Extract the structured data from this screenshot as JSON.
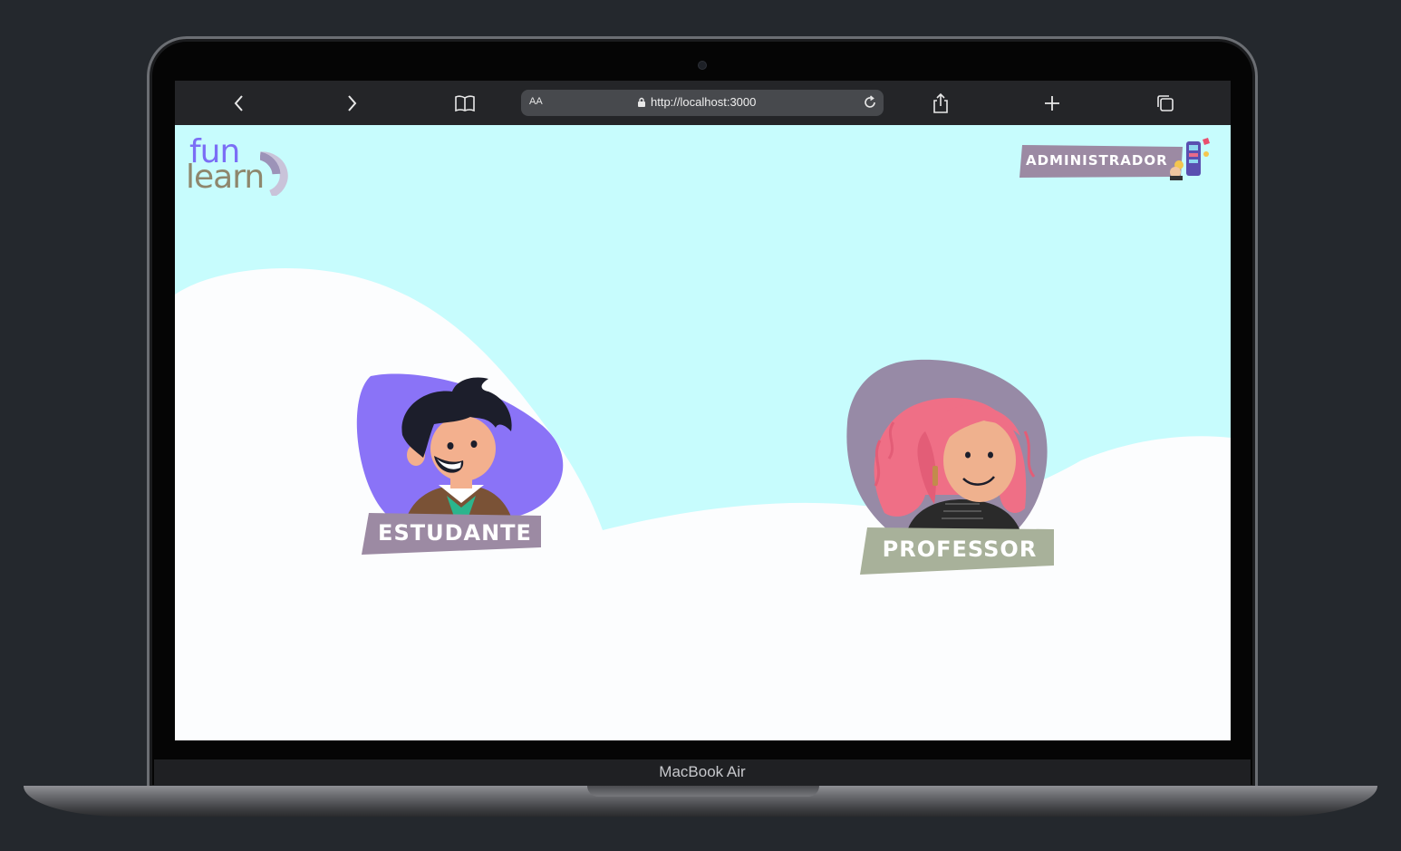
{
  "device": {
    "brand": "MacBook Air"
  },
  "browser": {
    "text_size_label": "AA",
    "url": "http://localhost:3000",
    "icons": [
      "back-icon",
      "forward-icon",
      "bookmarks-icon",
      "lock-icon",
      "reload-icon",
      "share-icon",
      "new-tab-icon",
      "tabs-icon"
    ]
  },
  "app": {
    "logo": {
      "line1": "fun",
      "line2": "learn"
    },
    "admin_button": {
      "label": "ADMINISTRADOR"
    },
    "roles": [
      {
        "label": "ESTUDANTE",
        "tag_color": "#9c8aa3",
        "blob_color": "#8a73f7"
      },
      {
        "label": "PROFESSOR",
        "tag_color": "#a8b19a",
        "blob_color": "#978aa6"
      }
    ],
    "colors": {
      "sky": "#c7fcfd",
      "ground": "#fcfdfe",
      "logo_fun": "#7b6ef5",
      "logo_learn": "#8e876d"
    }
  }
}
